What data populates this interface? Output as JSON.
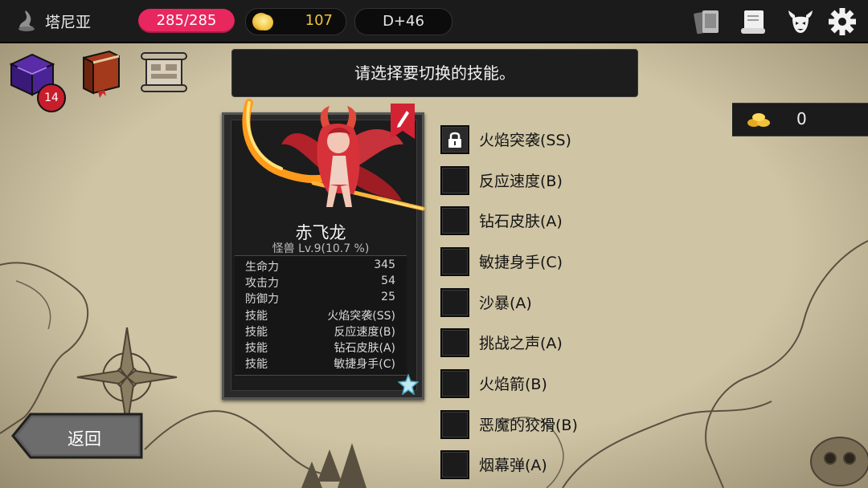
{
  "header": {
    "location": "塔尼亚",
    "hp": "285/285",
    "gold": "107",
    "day": "D+46",
    "icons": [
      "cards-icon",
      "map-scroll-icon",
      "demon-horns-icon",
      "gear-icon"
    ]
  },
  "items": {
    "chest_badge": "14",
    "icons": [
      "purple-chest-icon",
      "spellbook-icon",
      "scroll-icon"
    ]
  },
  "prompt": "请选择要切换的技能。",
  "counter": {
    "value": "0"
  },
  "card": {
    "name": "赤飞龙",
    "subtitle": "怪兽 Lv.9(10.7 %)",
    "stats": [
      {
        "label": "生命力",
        "value": "345"
      },
      {
        "label": "攻击力",
        "value": "54"
      },
      {
        "label": "防御力",
        "value": "25"
      },
      {
        "label": "技能",
        "value": "火焰突袭(SS)"
      },
      {
        "label": "技能",
        "value": "反应速度(B)"
      },
      {
        "label": "技能",
        "value": "钻石皮肤(A)"
      },
      {
        "label": "技能",
        "value": "敏捷身手(C)"
      }
    ]
  },
  "skills": [
    {
      "label": "火焰突袭(SS)",
      "locked": true
    },
    {
      "label": "反应速度(B)",
      "locked": false
    },
    {
      "label": "钻石皮肤(A)",
      "locked": false
    },
    {
      "label": "敏捷身手(C)",
      "locked": false
    },
    {
      "label": "沙暴(A)",
      "locked": false
    },
    {
      "label": "挑战之声(A)",
      "locked": false
    },
    {
      "label": "火焰箭(B)",
      "locked": false
    },
    {
      "label": "恶魔的狡猾(B)",
      "locked": false
    },
    {
      "label": "烟幕弹(A)",
      "locked": false
    }
  ],
  "back_label": "返回",
  "colors": {
    "hp": "#e8275f",
    "gold": "#f2c23a",
    "badge": "#c81e2c",
    "parchment": "#c9bd9c",
    "panel": "#1c1c1c"
  }
}
